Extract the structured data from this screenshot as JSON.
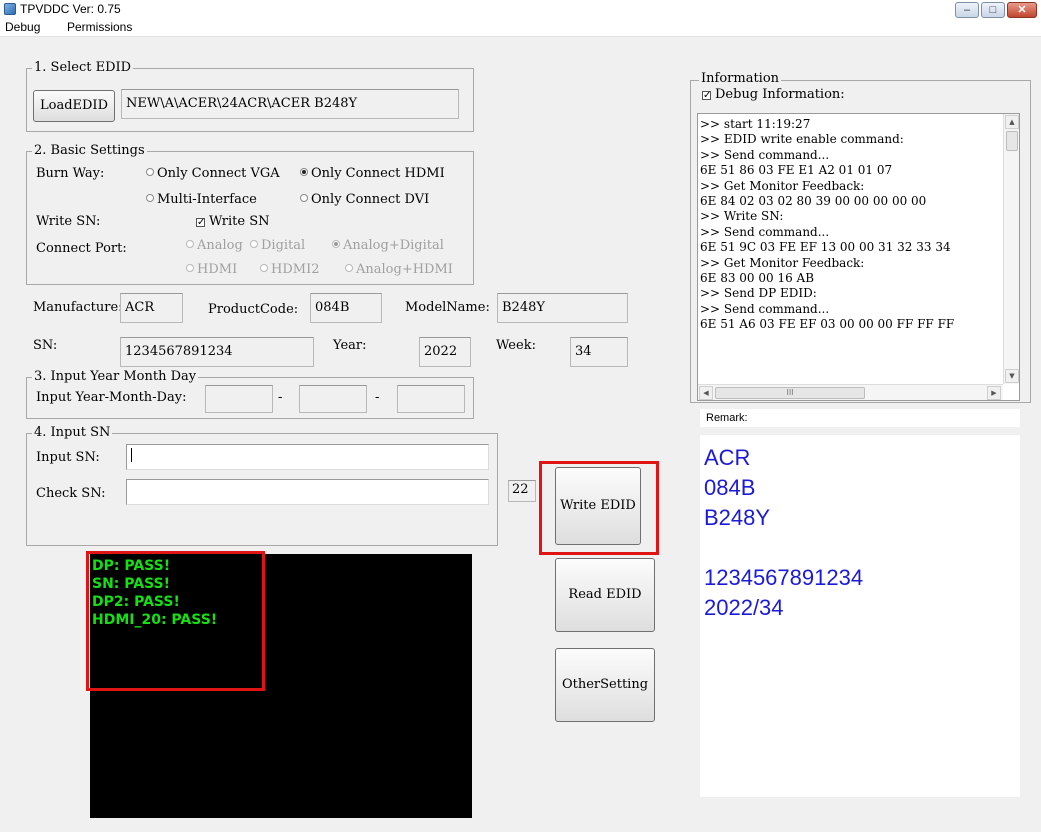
{
  "window": {
    "title": "TPVDDC  Ver: 0.75",
    "min": "–",
    "max": "□",
    "close": "✕"
  },
  "menu": [
    "Debug",
    "Permissions"
  ],
  "select_edid": {
    "legend": "1. Select EDID",
    "load_button": "LoadEDID",
    "path": "NEW\\A\\ACER\\24ACR\\ACER B248Y"
  },
  "basic_settings": {
    "legend": "2. Basic Settings",
    "burn_way_label": "Burn Way:",
    "burn_options": [
      {
        "label": "Only Connect VGA",
        "checked": false
      },
      {
        "label": "Only Connect HDMI",
        "checked": true
      },
      {
        "label": "Multi-Interface",
        "checked": false
      },
      {
        "label": "Only Connect DVI",
        "checked": false
      }
    ],
    "write_sn_label": "Write SN:",
    "write_sn_checkbox": {
      "label": "Write SN",
      "checked": true
    },
    "connect_port_label": "Connect Port:",
    "port_options": [
      {
        "label": "Analog",
        "checked": false
      },
      {
        "label": "Digital",
        "checked": false
      },
      {
        "label": "Analog+Digital",
        "checked": true
      },
      {
        "label": "HDMI",
        "checked": false
      },
      {
        "label": "HDMI2",
        "checked": false
      },
      {
        "label": "Analog+HDMI",
        "checked": false
      }
    ]
  },
  "fields": {
    "manufacture_label": "Manufacture:",
    "manufacture": "ACR",
    "product_code_label": "ProductCode:",
    "product_code": "084B",
    "model_name_label": "ModelName:",
    "model_name": "B248Y",
    "sn_label": "SN:",
    "sn": "1234567891234",
    "year_label": "Year:",
    "year": "2022",
    "week_label": "Week:",
    "week": "34"
  },
  "ymd": {
    "legend": "3. Input Year Month Day",
    "label": "Input Year-Month-Day:",
    "sep": "-",
    "year": "",
    "month": "",
    "day": ""
  },
  "input_sn": {
    "legend": "4. Input SN",
    "input_label": "Input SN:",
    "input_value": "",
    "check_label": "Check SN:",
    "check_value": "",
    "length": "22"
  },
  "buttons": {
    "write": "Write EDID",
    "read": "Read EDID",
    "other": "OtherSetting"
  },
  "results": [
    "DP: PASS!",
    "SN: PASS!",
    "DP2: PASS!",
    "HDMI_20: PASS!"
  ],
  "information": {
    "legend": "Information",
    "debug_label": "Debug Information:",
    "debug_checked": true,
    "log": [
      ">> start  11:19:27",
      ">> EDID write enable command:",
      ">> Send command...",
      "6E 51 86 03 FE E1 A2 01 01 07",
      ">> Get Monitor Feedback:",
      "6E 84 02 03 02 80 39 00 00 00 00 00",
      ">> Write SN:",
      ">> Send command...",
      "6E 51 9C 03 FE EF 13 00 00 31 32 33 34",
      ">> Get Monitor Feedback:",
      "6E 83 00 00 16 AB",
      ">> Send DP EDID:",
      ">> Send command...",
      "6E 51 A6 03 FE EF 03 00 00 00 FF FF FF"
    ],
    "scroll_up": "▲",
    "scroll_down": "▼",
    "scroll_left": "◀",
    "scroll_right": "▶",
    "grip": "III"
  },
  "remark": {
    "label": "Remark:",
    "lines": [
      "ACR",
      "084B",
      "B248Y",
      "",
      "1234567891234",
      "2022/34"
    ]
  },
  "colors": {
    "pass_text": "#14e014",
    "remark_text": "#1a1ad8",
    "highlight": "#e01414"
  }
}
